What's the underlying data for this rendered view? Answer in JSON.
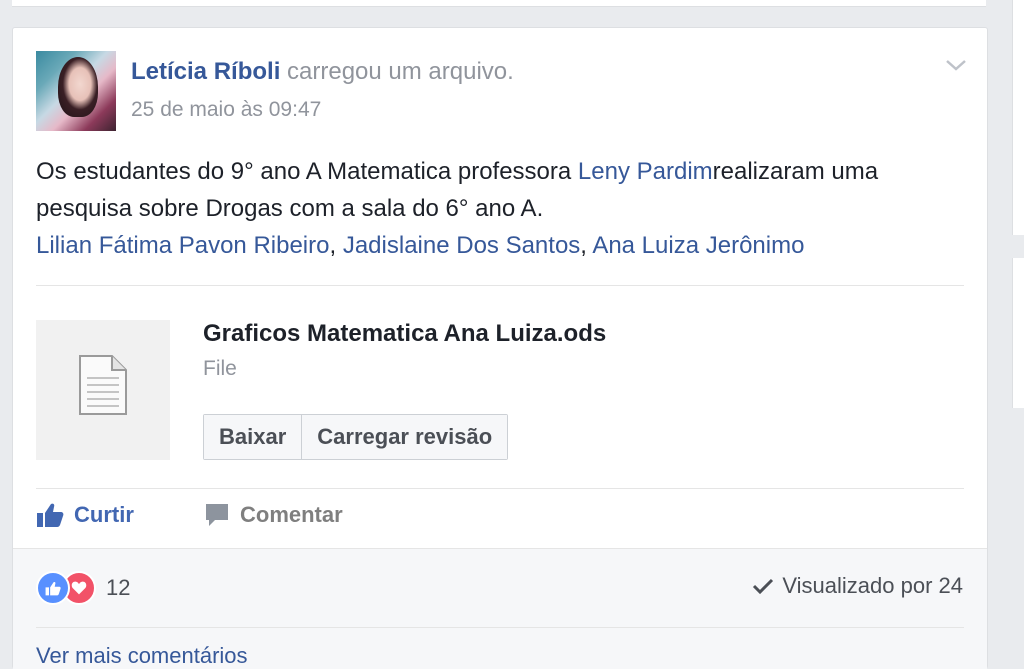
{
  "post": {
    "author_name": "Letícia Ríboli",
    "action_text": "carregou um arquivo.",
    "timestamp": "25 de maio às 09:47",
    "text_part1": "Os estudantes do 9° ano A Matematica professora ",
    "mention_teacher": "Leny Pardim",
    "text_part2": "realizaram uma pesquisa sobre Drogas com a sala do 6° ano A.",
    "tagged": [
      "Lilian Fátima Pavon Ribeiro",
      "Jadislaine Dos Santos",
      "Ana Luiza Jerônimo"
    ],
    "tag_separator": ", "
  },
  "file": {
    "name": "Graficos Matematica Ana Luiza.ods",
    "type": "File",
    "icon": "document-icon",
    "download_label": "Baixar",
    "upload_revision_label": "Carregar revisão"
  },
  "actions": {
    "like_label": "Curtir",
    "comment_label": "Comentar"
  },
  "footer": {
    "reaction_count": "12",
    "seen_label": "Visualizado por 24",
    "partial_link": "Ver mais comentários"
  },
  "colors": {
    "link": "#365899",
    "like_blue": "#4267b2",
    "love_red": "#f25268",
    "background": "#e9ebee"
  }
}
